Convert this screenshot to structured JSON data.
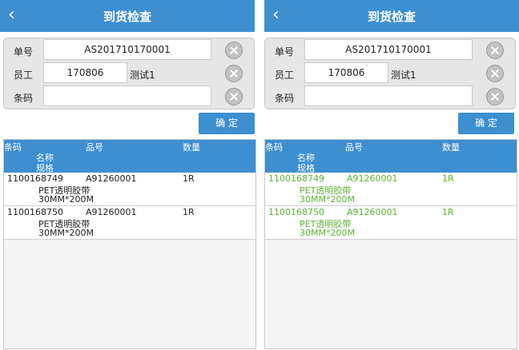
{
  "header": {
    "back_glyph": "‹",
    "title": "到货检查"
  },
  "form": {
    "order_label": "单号",
    "order_value": "AS201710170001",
    "employee_label": "员工",
    "employee_value": "170806",
    "employee_name": "测试1",
    "barcode_label": "条码",
    "barcode_value": ""
  },
  "confirm_label": "确 定",
  "columns": {
    "barcode": "条码",
    "part_no": "品号",
    "qty": "数量",
    "name": "名称",
    "spec": "规格"
  },
  "items": [
    {
      "barcode": "1100168749",
      "part_no": "A91260001",
      "qty": "1R",
      "name": "PET透明胶带",
      "spec": "30MM*200M"
    },
    {
      "barcode": "1100168750",
      "part_no": "A91260001",
      "qty": "1R",
      "name": "PET透明胶带",
      "spec": "30MM*200M"
    }
  ],
  "colors": {
    "accent": "#3d8fd0",
    "scanned": "#5cb335"
  },
  "icons": {
    "back": "back-chevron-icon",
    "clear": "clear-x-icon"
  }
}
